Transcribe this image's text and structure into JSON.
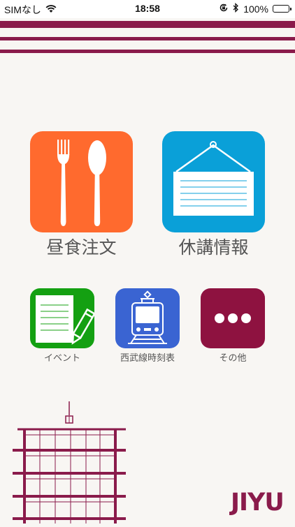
{
  "status_bar": {
    "carrier": "SIMなし",
    "time": "18:58",
    "battery": "100%"
  },
  "menu": {
    "primary": [
      {
        "label": "昼食注文",
        "icon": "fork-spoon-icon",
        "color": "#ff6a2e"
      },
      {
        "label": "休講情報",
        "icon": "notice-board-icon",
        "color": "#0aa0d8"
      }
    ],
    "secondary": [
      {
        "label": "イベント",
        "icon": "notebook-pencil-icon",
        "color": "#14a012"
      },
      {
        "label": "西武線時刻表",
        "icon": "train-icon",
        "color": "#3a64d2"
      },
      {
        "label": "その他",
        "icon": "more-dots-icon",
        "color": "#8e1240"
      }
    ]
  },
  "brand": {
    "logo": "JIYU",
    "color": "#8a1b4b"
  }
}
